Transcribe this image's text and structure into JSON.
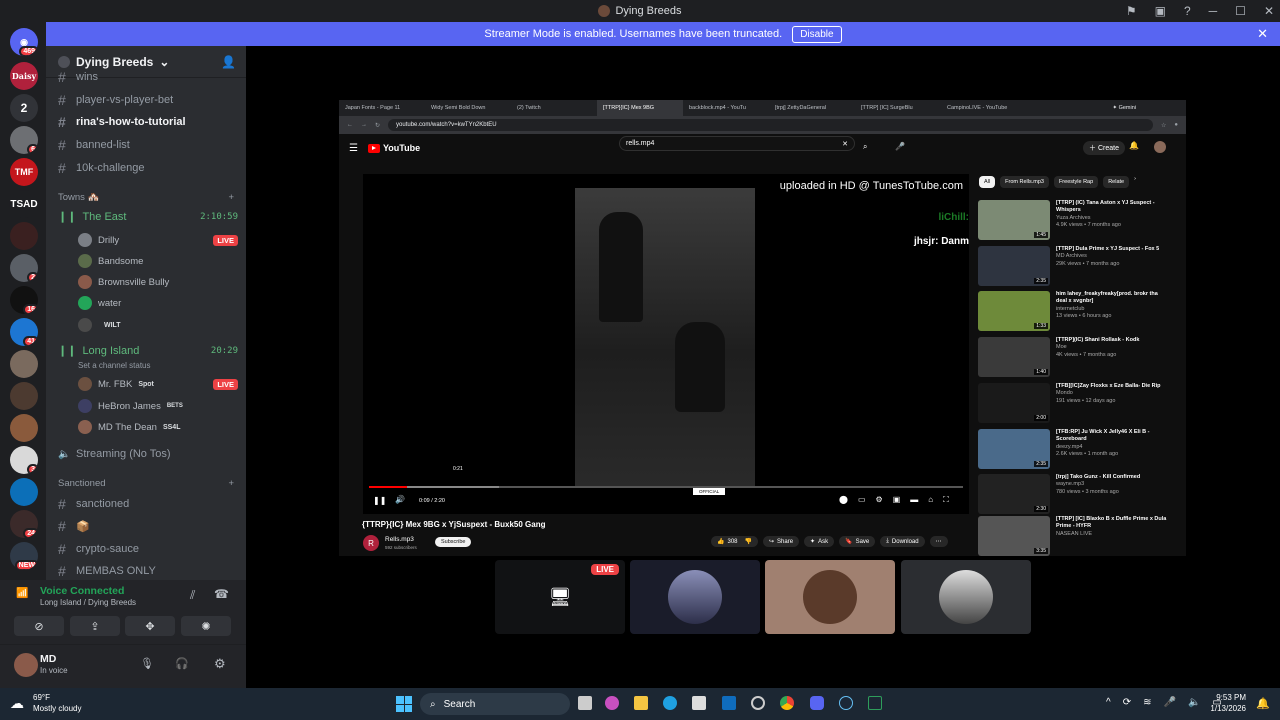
{
  "window": {
    "title": "Dying Breeds"
  },
  "banner": {
    "text": "Streamer Mode is enabled. Usernames have been truncated.",
    "disable_label": "Disable"
  },
  "servers": [
    {
      "label": "",
      "badge": "469"
    },
    {
      "label": "Daisy",
      "badge": ""
    },
    {
      "label": "2",
      "badge": ""
    },
    {
      "label": "",
      "badge": "6"
    },
    {
      "label": "TMF",
      "badge": ""
    },
    {
      "label": "TSAD",
      "badge": ""
    },
    {
      "label": "",
      "badge": ""
    },
    {
      "label": "",
      "badge": "2"
    },
    {
      "label": "",
      "badge": "16"
    },
    {
      "label": "",
      "badge": "41"
    },
    {
      "label": "",
      "badge": ""
    },
    {
      "label": "",
      "badge": ""
    },
    {
      "label": "",
      "badge": ""
    },
    {
      "label": "",
      "badge": "3"
    },
    {
      "label": "",
      "badge": ""
    },
    {
      "label": "",
      "badge": "24"
    },
    {
      "label": "",
      "badge": "NEW"
    }
  ],
  "server": {
    "name": "Dying Breeds"
  },
  "channels": {
    "top": [
      "wins",
      "player-vs-player-bet",
      "rina's-how-to-tutorial",
      "banned-list",
      "10k-challenge"
    ],
    "towns_label": "Towns 🏘️",
    "voice1": {
      "name": "The East",
      "time": "2:10:59",
      "users": [
        {
          "name": "Drilly",
          "tag": "",
          "live": "LIVE"
        },
        {
          "name": "Bandsome",
          "tag": "",
          "live": ""
        },
        {
          "name": "Brownsville Bully",
          "tag": "",
          "live": ""
        },
        {
          "name": "water",
          "tag": "",
          "live": ""
        },
        {
          "name": "",
          "tag": "WILT",
          "live": ""
        }
      ]
    },
    "voice2": {
      "name": "Long Island",
      "time": "20:29",
      "status": "Set a channel status",
      "users": [
        {
          "name": "Mr. FBK",
          "tag": "Spot",
          "live": "LIVE"
        },
        {
          "name": "HeBron James",
          "tag": "BETS",
          "live": ""
        },
        {
          "name": "MD The Dean",
          "tag": "SS4L",
          "live": ""
        }
      ]
    },
    "streaming": "Streaming (No Tos)",
    "sanctioned_label": "Sanctioned",
    "bottom": [
      "sanctioned",
      "📦",
      "crypto-sauce",
      "MEMBAS ONLY"
    ]
  },
  "voice_panel": {
    "status": "Voice Connected",
    "location": "Long Island / Dying Breeds"
  },
  "user_panel": {
    "name": "MD",
    "status": "In voice"
  },
  "browser": {
    "tabs": [
      "Japan Fonts - Page 11",
      "Widy Semi Bold Down",
      "(2) Twitch",
      "[TTRP]{IC} Mex 9BG",
      "backblock.mp4 - YouTu",
      "[trpj] ZettyDaGeneral",
      "[TTRP] [IC] SurgeBlu",
      "CampinoLIVE - YouTube"
    ],
    "gemini": "Gemini",
    "url": "youtube.com/watch?v=kwTYn2KbtEU"
  },
  "youtube": {
    "logo": "YouTube",
    "search": "rells.mp4",
    "create": "Create",
    "overlay": "uploaded in HD @ TunesToTube.com",
    "chat1": "liChill:",
    "chat2": "jhsjr: Danm",
    "hover_time": "0:21",
    "time": "0:09 / 2:20",
    "watermark": "OFFICIAL",
    "video_title": "{TTRP}{IC} Mex 9BG x YjSuspext - Buxk50 Gang",
    "channel": "Rells.mp3",
    "subs": "592 subscribers",
    "subscribe": "Subscribe",
    "likes": "308",
    "actions": [
      "Share",
      "Ask",
      "Save",
      "Download"
    ],
    "chips": [
      "All",
      "From Rells.mp3",
      "Freestyle Rap",
      "Relate"
    ],
    "recs": [
      {
        "title": "[TTRP] (IC) Tana Aston x YJ Suspect - Whispers",
        "channel": "Yuza Archives",
        "meta": "4.9K views • 7 months ago",
        "dur": "1:45"
      },
      {
        "title": "[TTRP] Dula Prime x YJ Suspect - Fox 5",
        "channel": "MD Archives",
        "meta": "29K views • 7 months ago",
        "dur": "2:35"
      },
      {
        "title": "him lahey_freakyfreaky[prod. brokr tha deal x svgnbr]",
        "channel": "internetclub",
        "meta": "13 views • 6 hours ago",
        "dur": "1:33"
      },
      {
        "title": "[TTRP](IC) Shani Rollask - Kodk",
        "channel": "Moe",
        "meta": "4K views • 7 months ago",
        "dur": "1:40"
      },
      {
        "title": "[TFB][IC]Zay Floxks x Eze Balla- Die Rip",
        "channel": "Mondo",
        "meta": "191 views • 12 days ago",
        "dur": "2:00"
      },
      {
        "title": "[TFB:RP] Ju Wick X Jelly46 X Eli B - Scoreboard",
        "channel": "deezy.mp4",
        "meta": "2.6K views • 1 month ago",
        "dur": "2:35"
      },
      {
        "title": "[trpj] Tako Gunz - Kill Confirmed",
        "channel": "wayne.mp3",
        "meta": "780 views • 3 months ago",
        "dur": "2:30"
      },
      {
        "title": "[TTRP] [IC] Blaxko B x Duffle Prime x Dula Prime - HYFR",
        "channel": "NASEAN LIVE",
        "meta": "",
        "dur": "3:35"
      }
    ]
  },
  "stream_tiles": {
    "live": "LIVE"
  },
  "taskbar": {
    "temp": "69°F",
    "weather": "Mostly cloudy",
    "search": "Search",
    "time": "9:53 PM",
    "date": "1/13/2026"
  },
  "colors": {
    "accent": "#5865f2",
    "live": "#ed4245",
    "voice": "#5fba7d",
    "yt_red": "#ff0000"
  }
}
